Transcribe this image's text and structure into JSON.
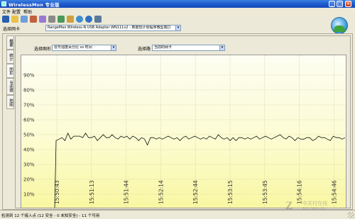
{
  "window": {
    "title": "WirelessMon 专业版",
    "minimize": "_",
    "maximize": "□",
    "close": "×"
  },
  "menu": [
    "文件",
    "配置",
    "帮助"
  ],
  "toolbar_icons": [
    "save-icon",
    "open-folder-icon",
    "network-icon",
    "settings-icon",
    "export-icon",
    "print-icon",
    "options-icon",
    "help-icon",
    "globe-icon",
    "info-icon",
    "monitor-icon"
  ],
  "adapter": {
    "label": "选择网卡",
    "value": "RangeMax Wireless-N USB Adapter WN111v2 - 数据包计划程序微型端口"
  },
  "tabs": [
    "概要",
    "统计",
    "图形",
    "IP连接",
    "地图"
  ],
  "graph_select": {
    "label": "选择图形",
    "value": "信号强度百分比 vs 时间"
  },
  "network_select": {
    "label": "选择路",
    "value": "当前的网卡"
  },
  "status": {
    "text": "检测到 12 个接入点 (12 安全 - 0 未知安全) - 11 个可用"
  },
  "watermark": {
    "text": "中关村在线",
    "url": "zol.com.cn"
  },
  "colors": {
    "accent": "#1e5ccf",
    "plot_bg_top": "#fdfdf2",
    "plot_bg_bottom": "#f9f7a2",
    "line": "#000000"
  },
  "chart_data": {
    "type": "line",
    "title": "",
    "xlabel": "",
    "ylabel": "",
    "ylim": [
      0,
      100
    ],
    "y_ticks": [
      "10%",
      "20%",
      "30%",
      "40%",
      "50%",
      "60%",
      "70%",
      "80%",
      "90%"
    ],
    "x_ticks": [
      "15:50:43",
      "15:51:13",
      "15:51:44",
      "15:52:14",
      "15:52:44",
      "15:53:15",
      "15:53:45",
      "15:54:16",
      "15:54:46"
    ],
    "grid": true,
    "series": [
      {
        "values": [
          0,
          46,
          47,
          48,
          46,
          51,
          47,
          49,
          49,
          49,
          48,
          51,
          48,
          48,
          49,
          46,
          48,
          50,
          48,
          48,
          50,
          48,
          47,
          49,
          48,
          49,
          47,
          49,
          48,
          46,
          48,
          47,
          43,
          48,
          48,
          47,
          48,
          47,
          48,
          49,
          48,
          47,
          48,
          46,
          48,
          49,
          47,
          48,
          49,
          48,
          47,
          48,
          47,
          49,
          48,
          47,
          50,
          48,
          47,
          48,
          46,
          48,
          46,
          48,
          48,
          47,
          48,
          47,
          48,
          49,
          47,
          48,
          49,
          48,
          47,
          48,
          49,
          50,
          48,
          47,
          49,
          48,
          46,
          48,
          47,
          47,
          48,
          48,
          46,
          47,
          49,
          48,
          48,
          47,
          46,
          49,
          48,
          48,
          47,
          48
        ]
      }
    ]
  }
}
